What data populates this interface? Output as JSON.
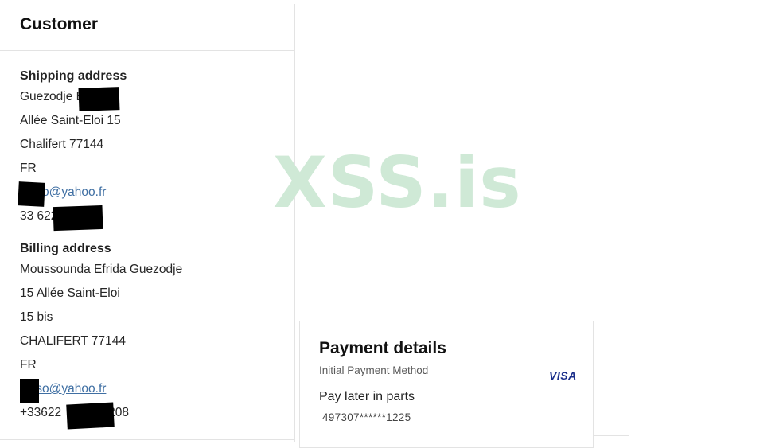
{
  "customer": {
    "title": "Customer",
    "shipping": {
      "label": "Shipping address",
      "name": "Guezodje E",
      "street": "Allée Saint-Eloi 15",
      "city": "Chalifert  77144",
      "country": "FR",
      "email": "tso@yahoo.fr",
      "phone": "33 622"
    },
    "billing": {
      "label": "Billing address",
      "name": "Moussounda Efrida Guezodje",
      "street": "15 Allée Saint-Eloi",
      "street2": "15 bis",
      "city": "CHALIFERT  77144",
      "country": "FR",
      "email": "tso@yahoo.fr",
      "phone": "+33622",
      "phone_tail": "208"
    }
  },
  "watermark": {
    "text": "XSS.is",
    "color": "#cfe9d6"
  },
  "payment": {
    "title": "Payment details",
    "subtitle": "Initial Payment Method",
    "card_brand": "VISA",
    "method": "Pay later in parts",
    "card_number": "497307******1225"
  },
  "colors": {
    "link": "#3f6fa3",
    "visa": "#1a2e8a",
    "border": "#e3e3e3"
  }
}
